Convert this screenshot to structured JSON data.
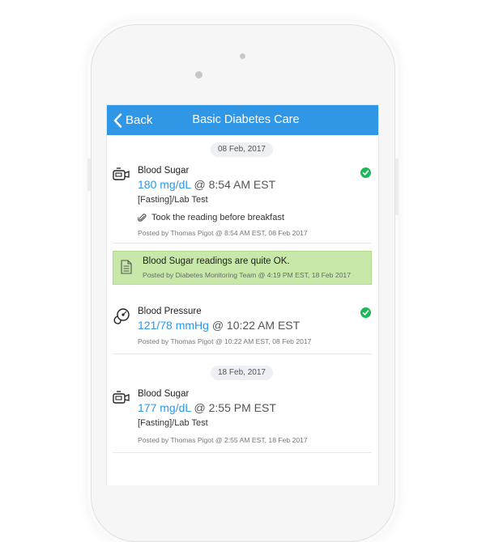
{
  "navbar": {
    "back_label": "Back",
    "title": "Basic Diabetes Care"
  },
  "dates": [
    "08 Feb, 2017",
    "18 Feb, 2017"
  ],
  "entries": [
    {
      "type": "Blood Sugar",
      "value": "180 mg/dL",
      "time": " @ 8:54 AM EST",
      "sub": "[Fasting]/Lab Test",
      "note": "Took the reading before breakfast",
      "posted": "Posted by Thomas Pigot @ 8:54 AM EST, 08 Feb 2017",
      "icon": "glucose-meter-icon",
      "checked": true
    },
    {
      "type": "Blood Pressure",
      "value": "121/78 mmHg",
      "time": " @ 10:22 AM EST",
      "posted": "Posted by Thomas Pigot @ 10:22 AM EST, 08 Feb 2017",
      "icon": "stethoscope-icon",
      "checked": true
    },
    {
      "type": "Blood Sugar",
      "value": "177 mg/dL",
      "time": " @ 2:55 PM EST",
      "sub": "[Fasting]/Lab Test",
      "posted": "Posted by Thomas Pigot @ 2:55 AM EST, 18 Feb 2017",
      "icon": "glucose-meter-icon",
      "checked": false
    }
  ],
  "message": {
    "text": "Blood Sugar readings are quite OK.",
    "posted": "Posted by Diabetes Monitoring Team @ 4:19 PM EST, 18 Feb 2017",
    "icon": "document-icon"
  },
  "colors": {
    "accent": "#2f97e5",
    "check": "#1fb85a",
    "message_bg": "#c7e8a8"
  }
}
